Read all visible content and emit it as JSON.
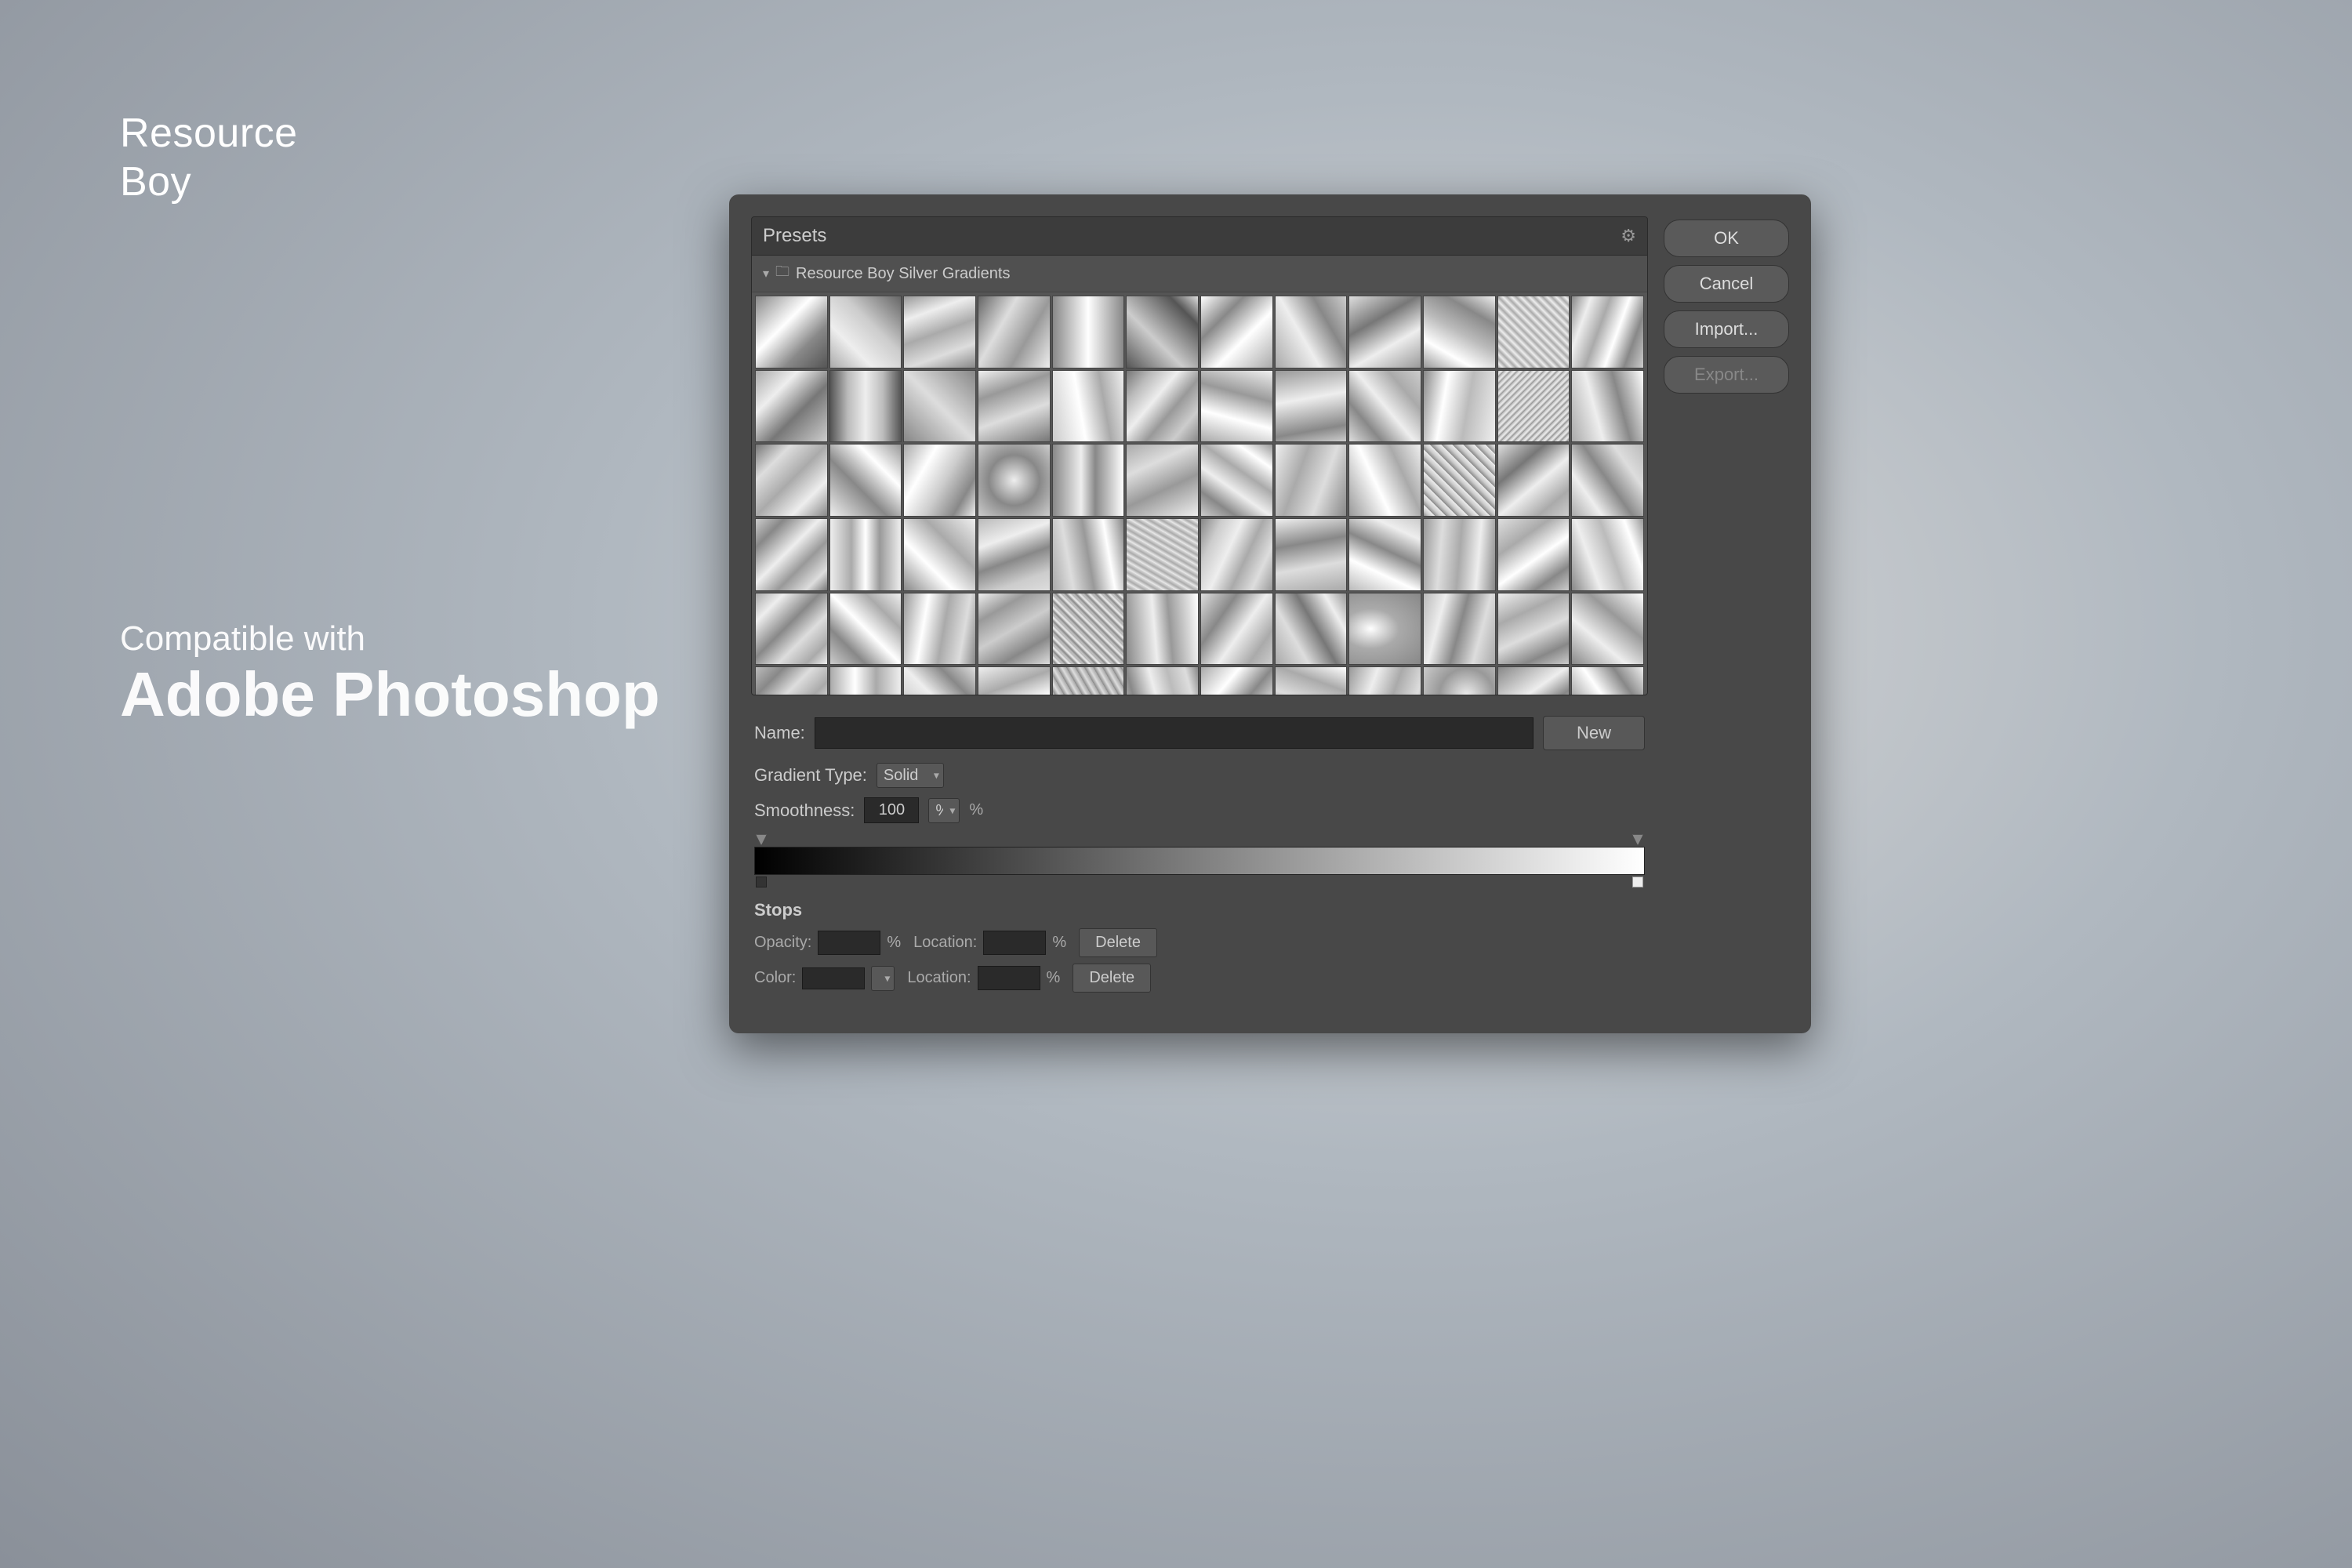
{
  "brand": {
    "name_line1": "Resource",
    "name_line2": "Boy"
  },
  "compatible_text": {
    "small": "Compatible with",
    "large": "Adobe Photoshop"
  },
  "dialog": {
    "presets_label": "Presets",
    "group_name": "Resource Boy Silver Gradients",
    "name_label": "Name:",
    "name_value": "",
    "gradient_type_label": "Gradient Type:",
    "gradient_type_value": "Solid",
    "smoothness_label": "Smoothness:",
    "smoothness_value": "100",
    "percent_symbol": "%",
    "stops_label": "Stops",
    "opacity_label": "Opacity:",
    "color_label": "Color:",
    "location_label1": "Location:",
    "location_label2": "Location:",
    "delete_label1": "Delete",
    "delete_label2": "Delete",
    "buttons": {
      "ok": "OK",
      "cancel": "Cancel",
      "import": "Import...",
      "export": "Export...",
      "new": "New"
    }
  },
  "icons": {
    "gear": "⚙",
    "folder": "📁",
    "chevron_down": "▾",
    "arrow_down": "▾"
  }
}
